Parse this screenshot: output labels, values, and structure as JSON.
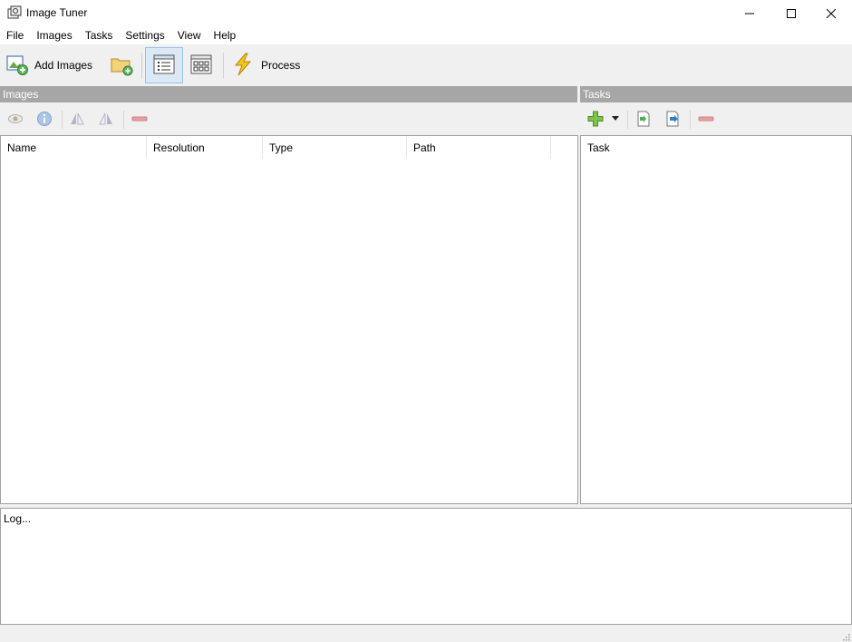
{
  "window": {
    "title": "Image Tuner"
  },
  "menu": [
    "File",
    "Images",
    "Tasks",
    "Settings",
    "View",
    "Help"
  ],
  "toolbar": {
    "add_images_label": "Add Images",
    "process_label": "Process"
  },
  "panels": {
    "images_title": "Images",
    "tasks_title": "Tasks"
  },
  "images_table": {
    "columns": [
      "Name",
      "Resolution",
      "Type",
      "Path"
    ]
  },
  "tasks_table": {
    "columns": [
      "Task"
    ]
  },
  "log": {
    "placeholder": "Log..."
  },
  "icons": {
    "app": "image-tuner-icon",
    "add_images": "add-image-icon",
    "add_folder": "add-folder-icon",
    "list_view": "list-view-icon",
    "grid_view": "grid-view-icon",
    "process": "lightning-icon",
    "preview": "eye-icon",
    "info": "info-icon",
    "flip": "flip-icon",
    "rotate": "mirror-icon",
    "remove": "minus-icon",
    "add_task": "plus-icon",
    "dropdown": "caret-down-icon",
    "import": "import-icon",
    "export": "export-icon"
  },
  "colors": {
    "panel_header": "#a6a6a6",
    "selected_view": "#dbe9f7",
    "accent_green": "#5cb85c"
  }
}
